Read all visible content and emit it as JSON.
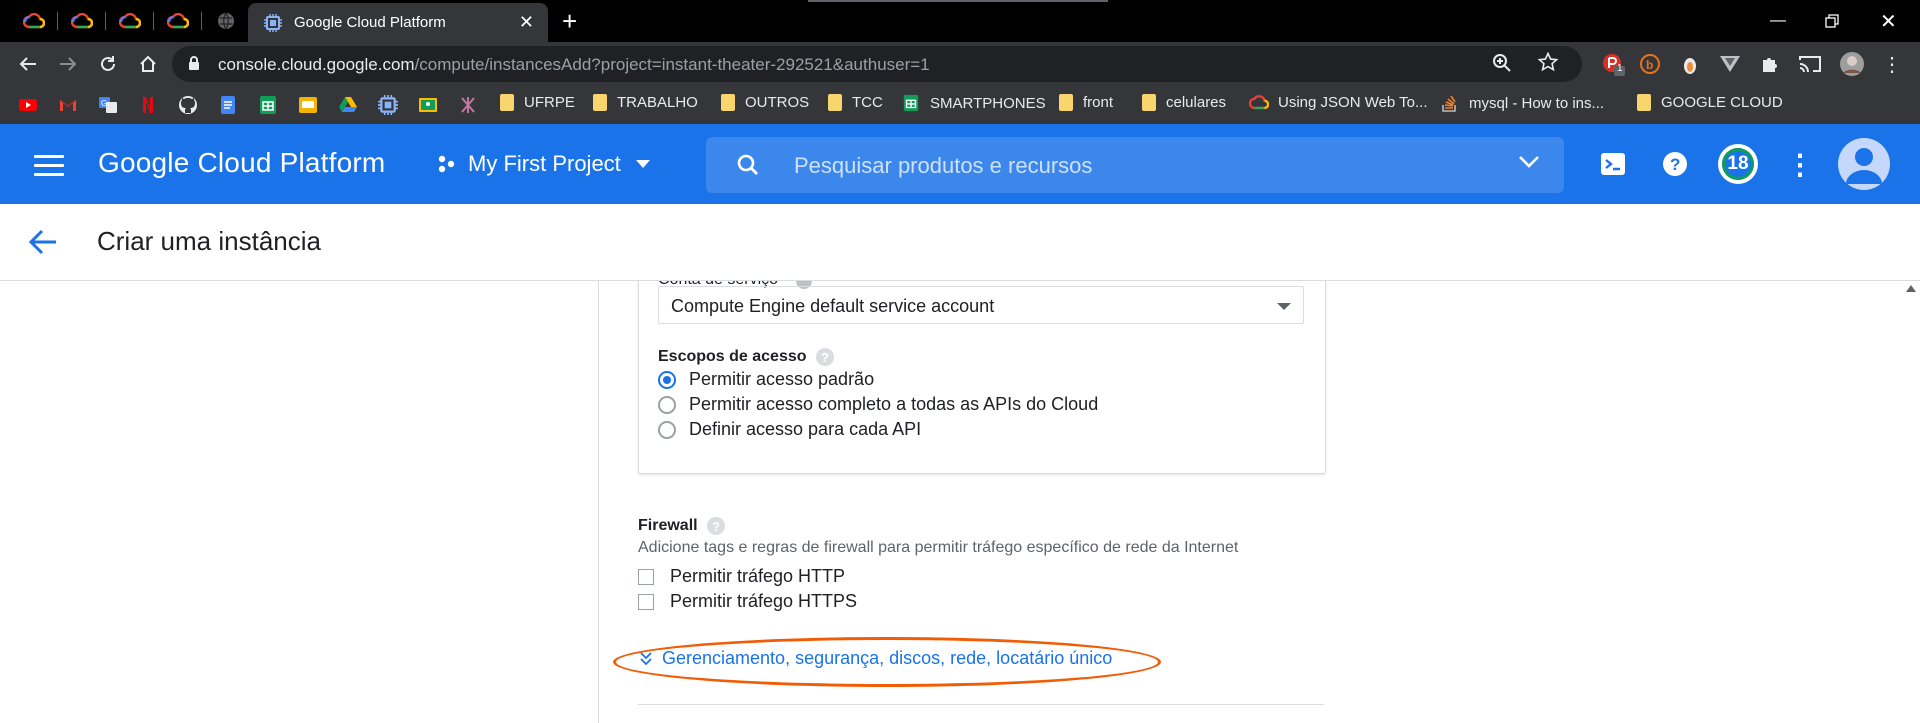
{
  "browser": {
    "tabs": [
      {
        "favicon": "google-cloud-icon"
      },
      {
        "favicon": "google-cloud-icon"
      },
      {
        "favicon": "google-cloud-icon"
      },
      {
        "favicon": "google-cloud-icon"
      },
      {
        "favicon": "globe-icon"
      }
    ],
    "active_tab": {
      "title": "Google Cloud Platform",
      "favicon": "chip-icon"
    },
    "url": {
      "host": "console.cloud.google.com",
      "path": "/compute/instancesAdd?project=instant-theater-292521&authuser=1"
    },
    "extension_badge": "1",
    "bookmarks": [
      {
        "type": "icon",
        "icon": "youtube-icon"
      },
      {
        "type": "icon",
        "icon": "gmail-icon"
      },
      {
        "type": "icon",
        "icon": "translate-icon"
      },
      {
        "type": "icon",
        "icon": "netflix-icon"
      },
      {
        "type": "icon",
        "icon": "github-icon"
      },
      {
        "type": "icon",
        "icon": "docs-icon"
      },
      {
        "type": "icon",
        "icon": "sheets-icon"
      },
      {
        "type": "icon",
        "icon": "slides-icon"
      },
      {
        "type": "icon",
        "icon": "drive-icon"
      },
      {
        "type": "icon",
        "icon": "chip-icon"
      },
      {
        "type": "icon",
        "icon": "classroom-icon"
      },
      {
        "type": "icon",
        "icon": "figma-like-icon"
      }
    ],
    "bookmark_folders": [
      "UFRPE",
      "TRABALHO",
      "OUTROS",
      "TCC",
      "SMARTPHONES",
      "front",
      "celulares",
      "Using JSON Web To...",
      "mysql - How to ins...",
      "GOOGLE CLOUD"
    ],
    "colors": {
      "chrome_dark": "#35363a",
      "tabstrip": "#000000",
      "folder": "#f9d56e"
    }
  },
  "gcp": {
    "brand": "Google Cloud Platform",
    "project": "My First Project",
    "search_placeholder": "Pesquisar produtos e recursos",
    "notifications_count": "18",
    "colors": {
      "header": "#1a73e8",
      "accent": "#1a73e8",
      "highlight_ring": "#f25c05"
    }
  },
  "page": {
    "title": "Criar uma instância",
    "service_account": {
      "label_partial": "Conta de serviço",
      "selected": "Compute Engine default service account"
    },
    "access_scopes": {
      "label": "Escopos de acesso",
      "options": [
        {
          "label": "Permitir acesso padrão",
          "selected": true
        },
        {
          "label": "Permitir acesso completo a todas as APIs do Cloud",
          "selected": false
        },
        {
          "label": "Definir acesso para cada API",
          "selected": false
        }
      ]
    },
    "firewall": {
      "label": "Firewall",
      "description": "Adicione tags e regras de firewall para permitir tráfego específico de rede da Internet",
      "options": [
        {
          "label": "Permitir tráfego HTTP",
          "checked": false
        },
        {
          "label": "Permitir tráfego HTTPS",
          "checked": false
        }
      ]
    },
    "expander_label": "Gerenciamento, segurança, discos, rede, locatário único"
  }
}
